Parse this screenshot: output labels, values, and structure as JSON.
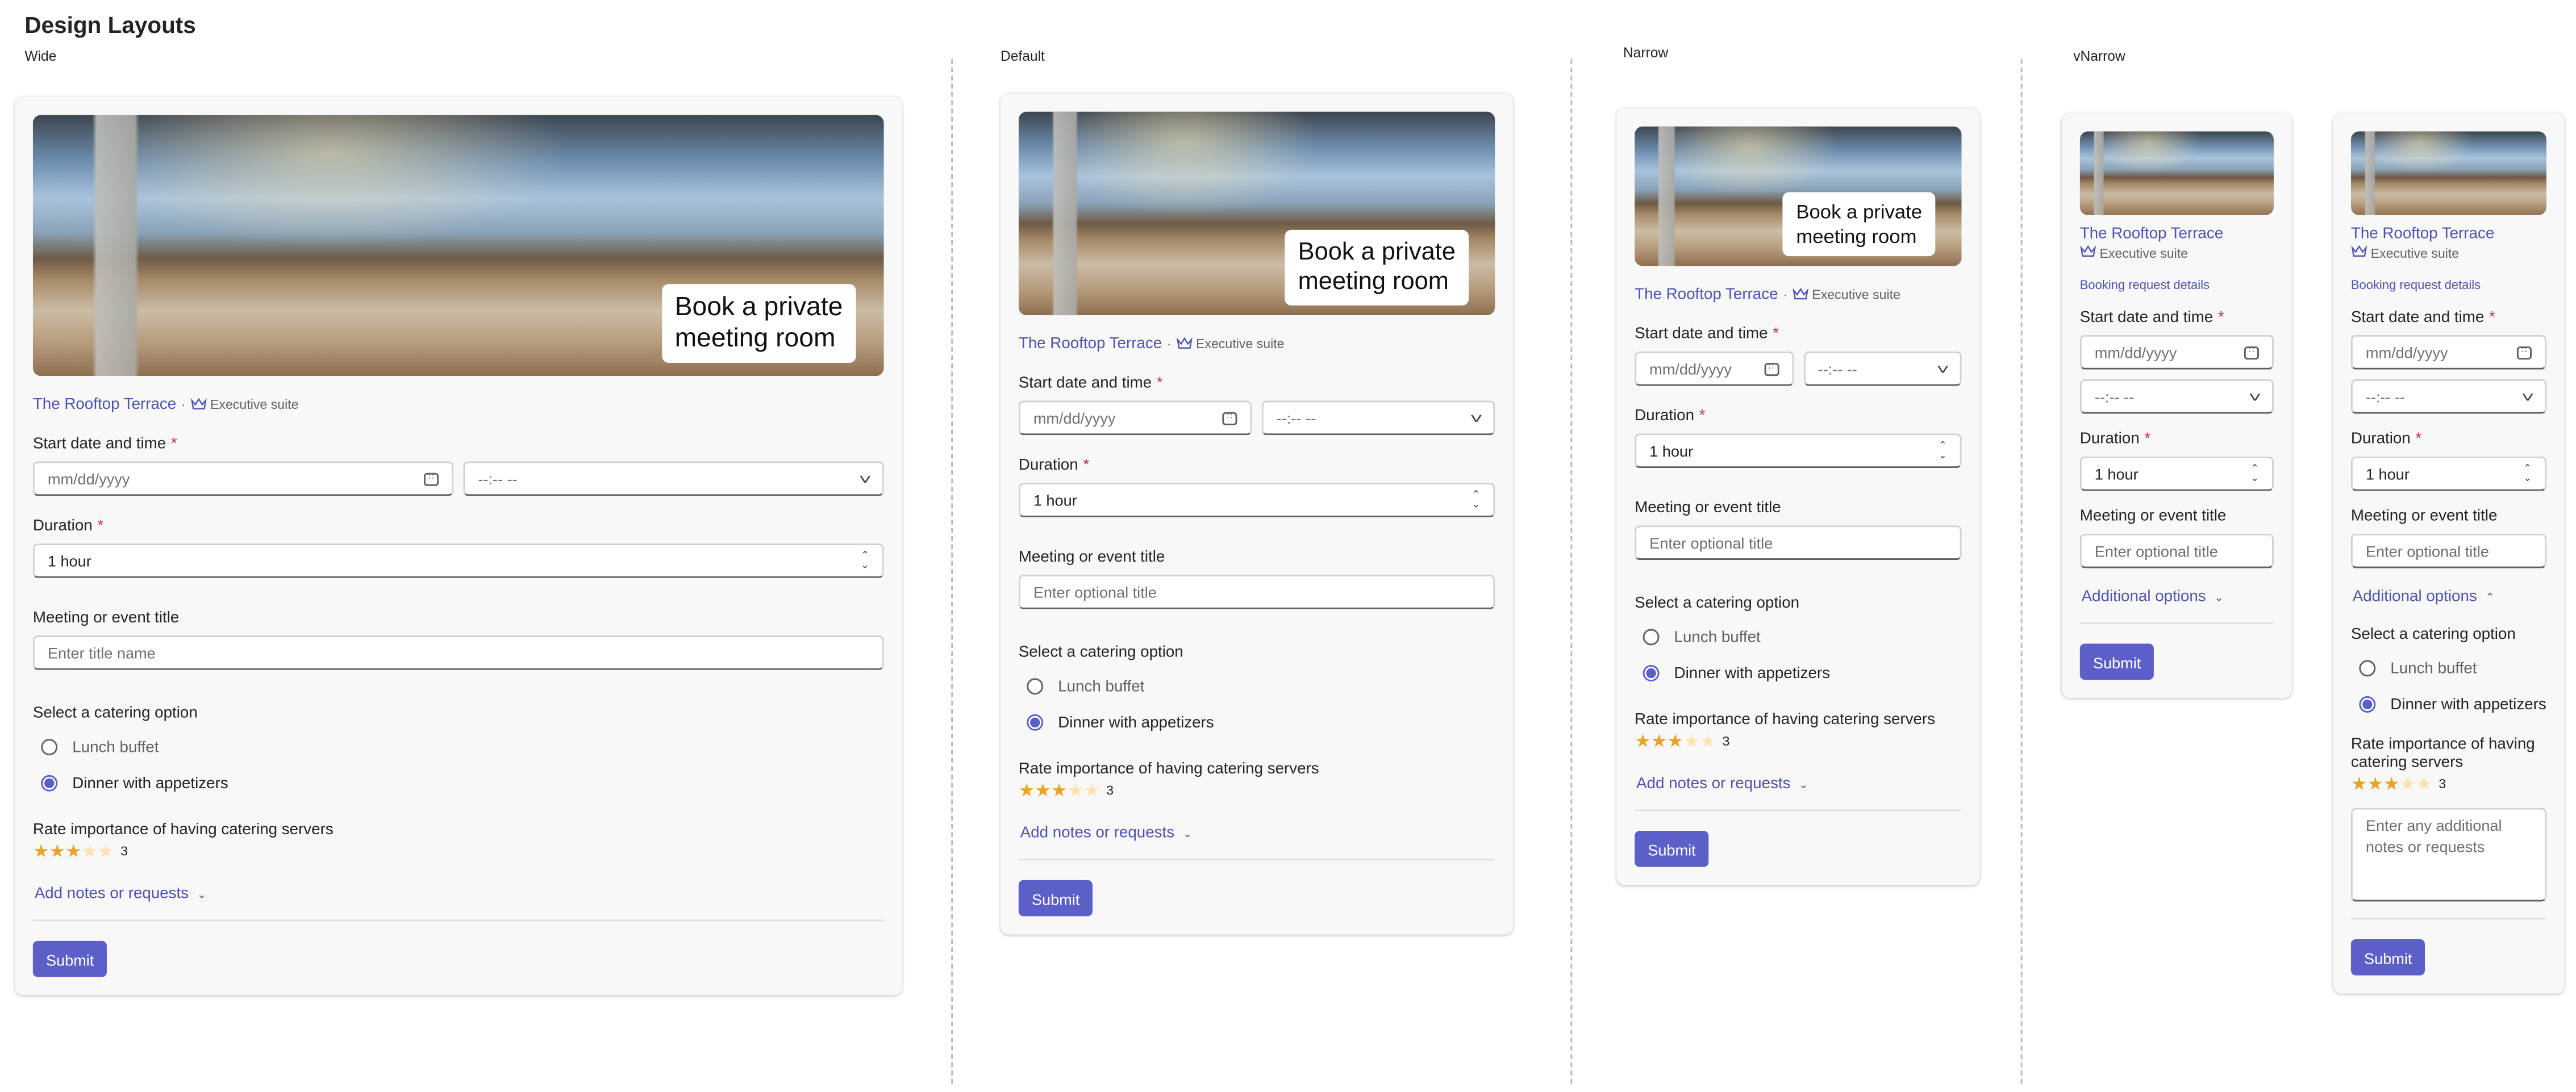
{
  "page": {
    "title": "Design Layouts"
  },
  "layout_labels": [
    "Wide",
    "Default",
    "Narrow",
    "vNarrow"
  ],
  "form": {
    "hero_lines": [
      "Book a private",
      "meeting room"
    ],
    "venue": "The Rooftop Terrace",
    "separator": "·",
    "suite": "Executive suite",
    "section_title": "Booking request details",
    "start_label": "Start date and time",
    "required_mark": "*",
    "date_placeholder": "mm/dd/yyyy",
    "time_placeholder": "--:-- --",
    "duration_label": "Duration",
    "duration_value": "1 hour",
    "title_label": "Meeting or event  title",
    "catering_label": "Select a catering option",
    "catering_options": [
      "Lunch buffet",
      "Dinner with appetizers"
    ],
    "catering_selected": 1,
    "rating_label": "Rate importance of having catering servers",
    "rating_value": "3",
    "rating": 3,
    "rating_max": 5,
    "notes_toggle": "Add notes or requests",
    "additional_toggle": "Additional options",
    "notes_placeholder": "Enter any additional notes or requests",
    "submit": "Submit",
    "accent": "#5b5fc7"
  },
  "cards": [
    {
      "variant": "wide",
      "title_placeholder": "Enter title name"
    },
    {
      "variant": "default",
      "title_placeholder": "Enter optional title"
    },
    {
      "variant": "narrow",
      "title_placeholder": "Enter optional title"
    },
    {
      "variant": "vnarrow-collapsed",
      "title_placeholder": "Enter optional title"
    },
    {
      "variant": "vnarrow-expanded",
      "title_placeholder": "Enter optional title"
    }
  ]
}
